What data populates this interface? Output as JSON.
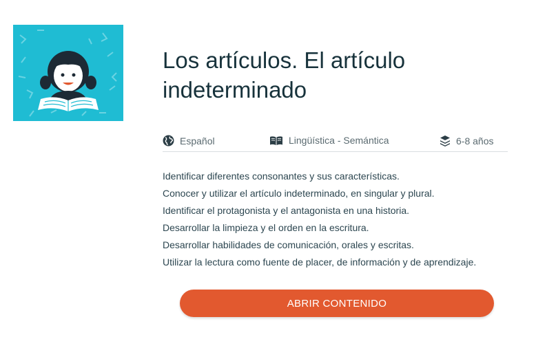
{
  "title": "Los artículos. El artículo indeterminado",
  "meta": {
    "language": "Español",
    "subject": "Lingüística - Semántica",
    "age": "6-8 años"
  },
  "objectives": [
    "Identificar diferentes consonantes y sus características.",
    "Conocer y utilizar el artículo indeterminado, en singular y plural.",
    "Identificar el protagonista y el antagonista en una historia.",
    "Desarrollar la limpieza y el orden en la escritura.",
    "Desarrollar habilidades de comunicación, orales y escritas.",
    "Utilizar la lectura como fuente de placer, de información y de aprendizaje."
  ],
  "open_button_label": "ABRIR CONTENIDO",
  "colors": {
    "thumb_bg": "#1fbcd3",
    "accent": "#e2592f"
  },
  "icons": [
    "globe-icon",
    "book-icon",
    "layers-icon"
  ]
}
